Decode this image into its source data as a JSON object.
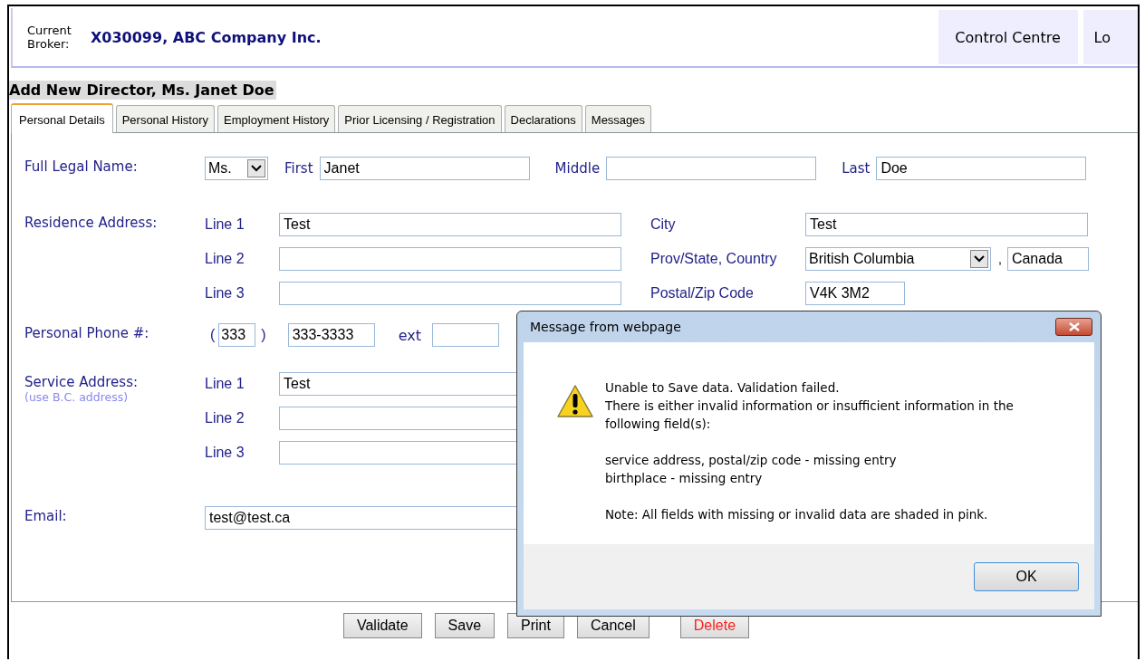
{
  "header": {
    "broker_label": "Current Broker:",
    "broker": "X030099, ABC Company Inc.",
    "nav": [
      "Control Centre",
      "Lo"
    ]
  },
  "title": "Add New Director, Ms. Janet Doe",
  "tabs": [
    {
      "label": "Personal Details",
      "selected": true
    },
    {
      "label": "Personal History",
      "selected": false
    },
    {
      "label": "Employment History",
      "selected": false
    },
    {
      "label": "Prior Licensing / Registration",
      "selected": false
    },
    {
      "label": "Declarations",
      "selected": false
    },
    {
      "label": "Messages",
      "selected": false
    }
  ],
  "form": {
    "name": {
      "label": "Full Legal Name:",
      "salutation": "Ms.",
      "fields": [
        {
          "label": "First",
          "value": "Janet"
        },
        {
          "label": "Middle"
        },
        {
          "label": "Last",
          "value": "Doe"
        }
      ]
    },
    "residence": {
      "label": "Residence Address:",
      "lines": [
        {
          "label": "Line 1",
          "value": "Test"
        },
        {
          "label": "Line 2"
        },
        {
          "label": "Line 3"
        }
      ],
      "city_label": "City",
      "city": "Test",
      "region_label": "Prov/State, Country",
      "province": "British Columbia",
      "separator": ",",
      "country": "Canada",
      "postal_label": "Postal/Zip Code",
      "postal": "V4K 3M2"
    },
    "phone": {
      "label": "Personal Phone #:",
      "open": "(",
      "area": "333",
      "close": ")",
      "number": "333-3333",
      "ext_label": "ext"
    },
    "service": {
      "label": "Service Address:",
      "note": "(use B.C. address)",
      "lines": [
        {
          "label": "Line 1",
          "value": "Test"
        },
        {
          "label": "Line 2"
        },
        {
          "label": "Line 3"
        }
      ]
    },
    "email": {
      "label": "Email:",
      "value": "test@test.ca"
    }
  },
  "buttons": [
    {
      "label": "Validate",
      "kind": "normal"
    },
    {
      "label": "Save",
      "kind": "normal"
    },
    {
      "label": "Print",
      "kind": "normal"
    },
    {
      "label": "Cancel",
      "kind": "normal"
    },
    {
      "label": "Delete",
      "kind": "danger"
    }
  ],
  "dialog": {
    "title": "Message from webpage",
    "paragraphs": [
      [
        "Unable to Save data. Validation failed.",
        "There is either invalid information or insufficient information in the following field(s):"
      ],
      [
        "service address, postal/zip code - missing entry",
        "birthplace - missing entry"
      ],
      [
        "Note: All fields with missing or invalid data are shaded in pink."
      ]
    ],
    "button": "OK"
  }
}
